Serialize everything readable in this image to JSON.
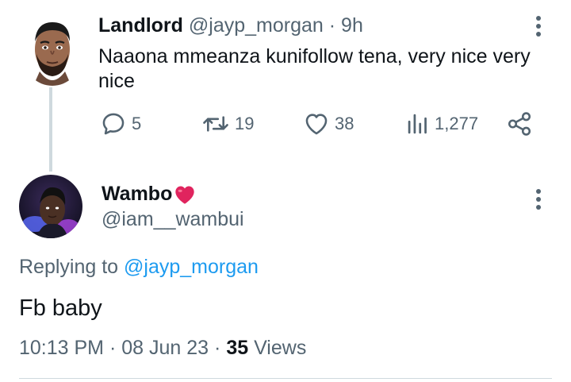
{
  "parent_tweet": {
    "display_name": "Landlord",
    "handle": "@jayp_morgan",
    "separator": "·",
    "time": "9h",
    "text": "Naaona mmeanza kunifollow tena, very nice very nice",
    "actions": {
      "replies": "5",
      "retweets": "19",
      "likes": "38",
      "views": "1,277"
    }
  },
  "reply_tweet": {
    "display_name": "Wambo",
    "name_emoji": "❤️",
    "handle": "@iam__wambui",
    "replying_prefix": "Replying to",
    "replying_to": "@jayp_morgan",
    "text": "Fb baby",
    "time": "10:13 PM",
    "separator": "·",
    "date": "08 Jun 23",
    "views_count": "35",
    "views_label": "Views"
  },
  "colors": {
    "primary_text": "#0f1419",
    "secondary_text": "#536471",
    "link": "#1d9bf0",
    "line": "#cfd9de",
    "heart_emoji": "#e0245e"
  }
}
